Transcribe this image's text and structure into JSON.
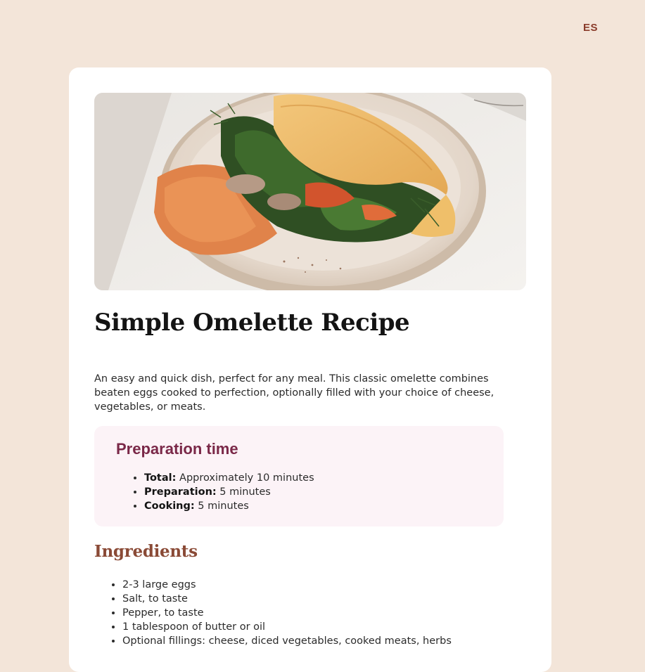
{
  "header": {
    "language_toggle": "ES"
  },
  "recipe": {
    "image_alt": "Omelette with spinach, dill, mushrooms and hummus on a plate",
    "title": "Simple Omelette Recipe",
    "intro": "An easy and quick dish, perfect for any meal. This classic omelette combines beaten eggs cooked to perfection, optionally filled with your choice of cheese, vegetables, or meats.",
    "preparation": {
      "heading": "Preparation time",
      "items": [
        {
          "label": "Total:",
          "value": " Approximately 10 minutes"
        },
        {
          "label": "Preparation:",
          "value": " 5 minutes"
        },
        {
          "label": "Cooking:",
          "value": " 5 minutes"
        }
      ]
    },
    "ingredients": {
      "heading": "Ingredients",
      "items": [
        "2-3 large eggs",
        "Salt, to taste",
        "Pepper, to taste",
        "1 tablespoon of butter or oil",
        "Optional fillings: cheese, diced vegetables, cooked meats, herbs"
      ]
    }
  },
  "colors": {
    "page_bg": "#f3e5d9",
    "card_bg": "#ffffff",
    "accent_brown": "#8a4a36",
    "accent_rose": "#7a2848",
    "prep_bg": "#fcf3f7"
  }
}
